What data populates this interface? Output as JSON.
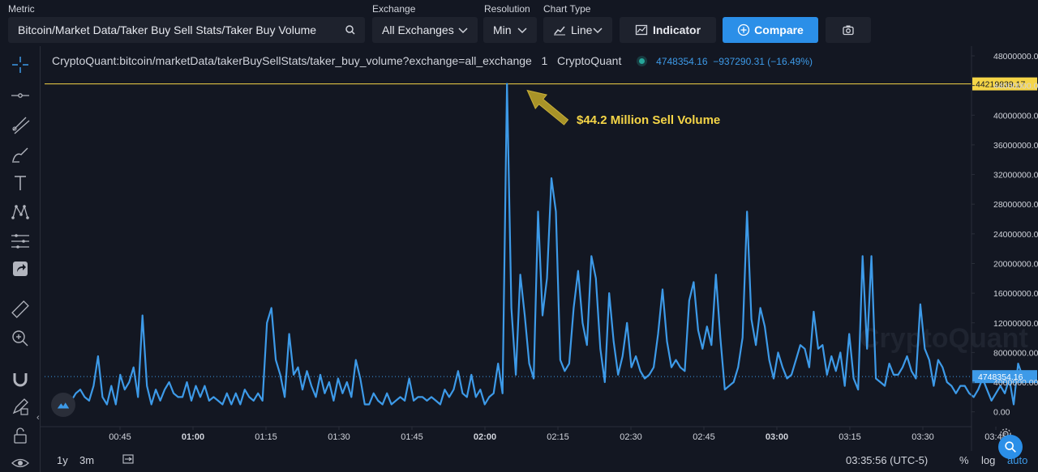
{
  "toolbar": {
    "metric_label": "Metric",
    "metric_value": "Bitcoin/Market Data/Taker Buy Sell Stats/Taker Buy Volume",
    "exchange_label": "Exchange",
    "exchange_value": "All Exchanges",
    "resolution_label": "Resolution",
    "resolution_value": "Min",
    "chart_type_label": "Chart Type",
    "chart_type_value": "Line",
    "indicator_label": "Indicator",
    "compare_label": "Compare",
    "accent_color": "#2b8fe8"
  },
  "sidebar": {
    "tools": [
      "crosshair-icon",
      "horizontal-line-icon",
      "trend-lines-icon",
      "brush-icon",
      "text-icon",
      "pattern-icon",
      "measure-lines-icon",
      "share-icon",
      "ruler-icon",
      "zoom-icon",
      "magnet-icon",
      "lock-draw-icon",
      "lock-icon",
      "eye-icon"
    ]
  },
  "legend": {
    "series": "CryptoQuant:bitcoin/marketData/takerBuySellStats/taker_buy_volume?exchange=all_exchange",
    "interval": "1",
    "source": "CryptoQuant",
    "last_value": "4748354.16",
    "change": "−937290.31",
    "change_pct": "(−16.49%)"
  },
  "annotation": {
    "text": "$44.2 Million Sell Volume",
    "color": "#f5d547"
  },
  "watermark": "CryptoQuant",
  "bottom": {
    "range_1y": "1y",
    "range_3m": "3m",
    "clock": "03:35:56 (UTC-5)",
    "percent": "%",
    "log": "log",
    "auto": "auto"
  },
  "chart_data": {
    "type": "line",
    "line_color": "#3d9ae8",
    "price_line": {
      "value": "44219839.17",
      "color": "#f5d547"
    },
    "last_price_label": "4748354.16",
    "y_ticks": [
      "48000000.00",
      "44000000.00",
      "40000000.00",
      "36000000.00",
      "32000000.00",
      "28000000.00",
      "24000000.00",
      "20000000.00",
      "16000000.00",
      "12000000.00",
      "8000000.00",
      "4000000.00",
      "0.00"
    ],
    "ylim": [
      -2000000,
      48000000
    ],
    "x_ticks": [
      {
        "label": "00:45",
        "t": 45,
        "bold": false
      },
      {
        "label": "01:00",
        "t": 60,
        "bold": true
      },
      {
        "label": "01:15",
        "t": 75,
        "bold": false
      },
      {
        "label": "01:30",
        "t": 90,
        "bold": false
      },
      {
        "label": "01:45",
        "t": 105,
        "bold": false
      },
      {
        "label": "02:00",
        "t": 120,
        "bold": true
      },
      {
        "label": "02:15",
        "t": 135,
        "bold": false
      },
      {
        "label": "02:30",
        "t": 150,
        "bold": false
      },
      {
        "label": "02:45",
        "t": 165,
        "bold": false
      },
      {
        "label": "03:00",
        "t": 180,
        "bold": true
      },
      {
        "label": "03:15",
        "t": 195,
        "bold": false
      },
      {
        "label": "03:30",
        "t": 210,
        "bold": false
      },
      {
        "label": "03:45",
        "t": 225,
        "bold": false
      }
    ],
    "x_minutes_start": 35,
    "y_values": [
      1500000,
      2500000,
      3000000,
      2000000,
      1500000,
      3500000,
      7500000,
      2000000,
      1000000,
      3500000,
      1000000,
      5000000,
      3000000,
      4000000,
      6000000,
      2000000,
      13000000,
      3500000,
      1000000,
      3000000,
      1500000,
      3000000,
      4000000,
      2500000,
      2000000,
      2000000,
      4000000,
      1500000,
      3500000,
      2000000,
      3500000,
      1500000,
      2000000,
      1500000,
      1000000,
      2500000,
      1000000,
      2500000,
      1000000,
      3000000,
      2000000,
      1500000,
      2500000,
      1500000,
      12000000,
      14000000,
      7000000,
      5000000,
      2000000,
      10500000,
      5000000,
      6000000,
      3000000,
      5500000,
      3500000,
      2000000,
      5000000,
      2500000,
      4000000,
      1500000,
      4500000,
      2500000,
      4000000,
      2000000,
      7000000,
      4500000,
      1000000,
      1000000,
      2500000,
      1500000,
      1000000,
      2500000,
      1000000,
      1500000,
      2000000,
      1500000,
      4500000,
      1500000,
      2000000,
      2000000,
      1500000,
      2000000,
      1500000,
      1000000,
      3000000,
      2000000,
      3000000,
      5500000,
      2500000,
      2000000,
      5000000,
      2000000,
      3000000,
      1000000,
      2000000,
      2500000,
      6500000,
      2500000,
      44219839,
      14000000,
      5000000,
      18500000,
      13000000,
      6500000,
      4500000,
      27000000,
      13000000,
      18000000,
      31500000,
      27000000,
      7000000,
      5500000,
      6500000,
      14000000,
      19000000,
      12000000,
      9000000,
      21000000,
      18000000,
      8500000,
      4000000,
      16000000,
      9500000,
      5000000,
      7500000,
      12000000,
      6000000,
      7500000,
      5500000,
      4500000,
      5000000,
      6000000,
      10500000,
      16500000,
      9500000,
      6000000,
      7000000,
      6000000,
      5500000,
      15000000,
      17500000,
      11000000,
      8500000,
      11500000,
      9000000,
      18500000,
      10000000,
      3000000,
      3500000,
      4000000,
      6000000,
      10000000,
      27000000,
      12500000,
      9000000,
      14000000,
      11500000,
      7000000,
      4500000,
      8000000,
      6000000,
      4500000,
      5000000,
      7000000,
      9000000,
      8500000,
      6000000,
      13500000,
      8500000,
      9000000,
      5000000,
      7500000,
      5500000,
      8000000,
      3500000,
      10500000,
      4500000,
      3000000,
      21000000,
      8500000,
      21000000,
      4500000,
      4000000,
      3500000,
      6500000,
      5000000,
      5000000,
      6000000,
      7500000,
      5500000,
      4500000,
      14500000,
      8500000,
      7000000,
      3500000,
      7000000,
      6000000,
      4000000,
      3500000,
      2500000,
      3500000,
      3500000,
      2500000,
      2000000,
      3000000,
      4500000,
      3000000,
      1500000,
      2500000,
      3500000,
      2500000,
      4500000,
      1000000,
      6500000,
      4748354
    ]
  }
}
